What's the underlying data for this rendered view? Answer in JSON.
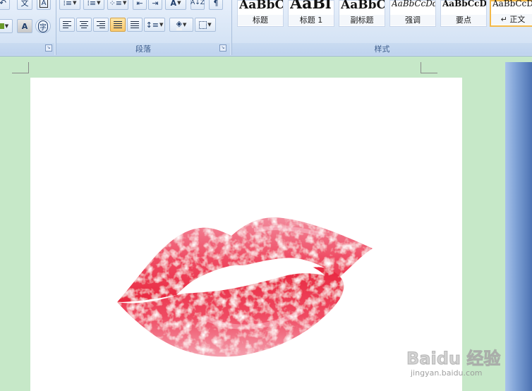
{
  "ribbon": {
    "paragraph_group_label": "段落",
    "styles_group_label": "样式",
    "font_buttons": {
      "wen": "文",
      "char_border": "A",
      "enclosed": "字"
    },
    "styles": [
      {
        "sample": "AaBbC",
        "label": "标题",
        "size": 17
      },
      {
        "sample": "AaBl",
        "label": "标题 1",
        "size": 22
      },
      {
        "sample": "AaBbC",
        "label": "副标题",
        "size": 17
      },
      {
        "sample": "AaBbCcDd",
        "label": "强调",
        "size": 12,
        "italic": true
      },
      {
        "sample": "AaBbCcD",
        "label": "要点",
        "size": 12
      },
      {
        "sample": "AaBbCcD",
        "label": "↵ 正文",
        "size": 12,
        "selected": true
      }
    ]
  },
  "watermark": {
    "brand": "Baidu 经验",
    "url": "jingyan.baidu.com"
  },
  "colors": {
    "lips_dark": "#e8263e",
    "lips_mid": "#ef4a62",
    "lips_light": "#f28a9c",
    "doc_bg": "#c6e8c8",
    "selected_style": "#f3b94a"
  }
}
